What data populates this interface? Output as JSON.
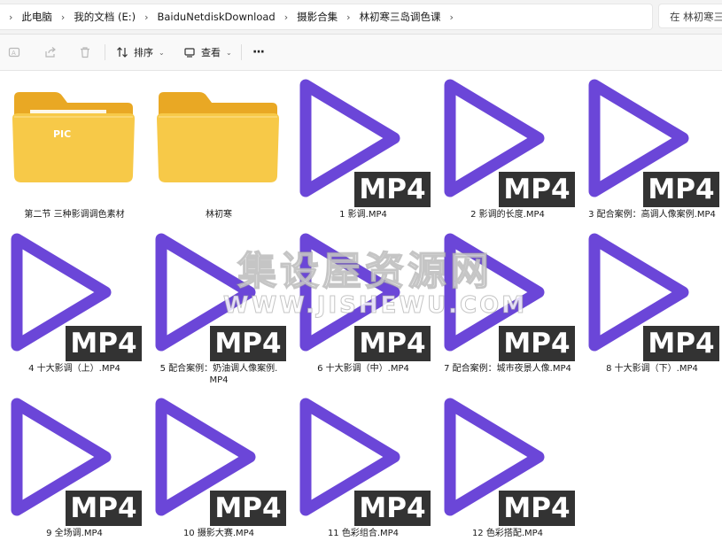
{
  "breadcrumb": [
    "此电脑",
    "我的文档 (E:)",
    "BaiduNetdiskDownload",
    "摄影合集",
    "林初寒三岛调色课"
  ],
  "search": {
    "placeholder": "在 林初寒三岛调色课 中搜索"
  },
  "toolbar": {
    "sort_label": "排序",
    "view_label": "查看",
    "more_label": "···"
  },
  "items": [
    {
      "name": "第二节 三种影调调色素材",
      "type": "folder-pic"
    },
    {
      "name": "林初寒",
      "type": "folder"
    },
    {
      "name": "1 影调.MP4",
      "type": "mp4"
    },
    {
      "name": "2 影调的长度.MP4",
      "type": "mp4"
    },
    {
      "name": "3 配合案例：高调人像案例.MP4",
      "type": "mp4"
    },
    {
      "name": "4 十大影调（上）.MP4",
      "type": "mp4"
    },
    {
      "name": "5 配合案例：奶油调人像案例.",
      "name2": "MP4",
      "type": "mp4"
    },
    {
      "name": "6 十大影调（中）.MP4",
      "type": "mp4"
    },
    {
      "name": "7 配合案例：城市夜景人像.MP4",
      "type": "mp4"
    },
    {
      "name": "8 十大影调（下）.MP4",
      "type": "mp4"
    },
    {
      "name": "9 全场调.MP4",
      "type": "mp4"
    },
    {
      "name": "10 摄影大赛.MP4",
      "type": "mp4"
    },
    {
      "name": "11 色彩组合.MP4",
      "type": "mp4"
    },
    {
      "name": "12 色彩搭配.MP4",
      "type": "mp4"
    }
  ],
  "mp4_badge": "MP4",
  "pic_badge": "PIC",
  "watermark": {
    "line1": "集设屋资源网",
    "line2": "WWW.JISHEWU.COM"
  },
  "colors": {
    "play_purple": "#6b46d8",
    "folder_yellow": "#f7c948",
    "badge_bg": "#333333"
  }
}
